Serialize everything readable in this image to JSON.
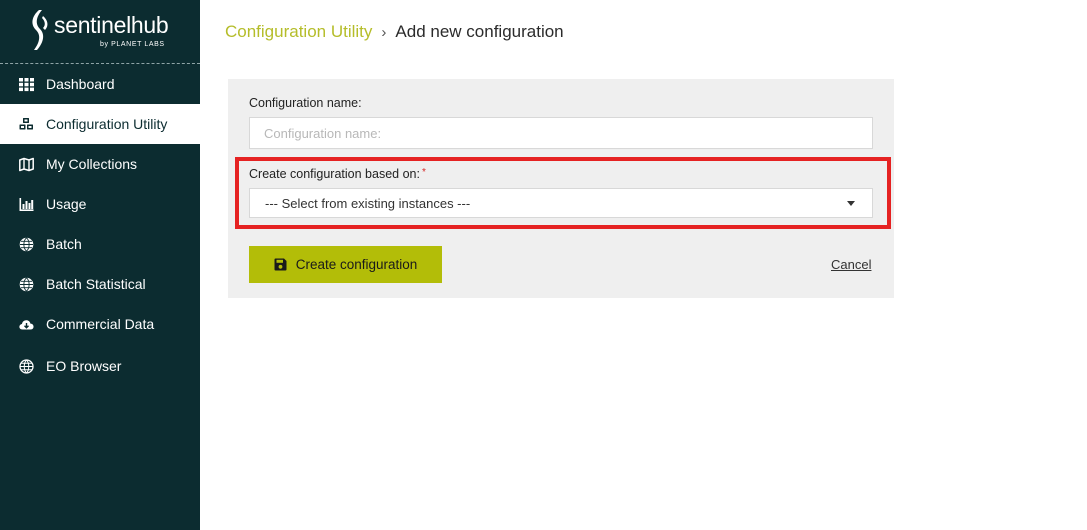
{
  "brand": {
    "name": "sentinelhub",
    "tagline": "by PLANET LABS"
  },
  "sidebar": {
    "items": [
      {
        "label": "Dashboard",
        "icon": "grid-icon"
      },
      {
        "label": "Configuration Utility",
        "icon": "cubes-icon",
        "active": true
      },
      {
        "label": "My Collections",
        "icon": "map-icon"
      },
      {
        "label": "Usage",
        "icon": "bar-chart-icon"
      },
      {
        "label": "Batch",
        "icon": "globe-icon"
      },
      {
        "label": "Batch Statistical",
        "icon": "globe-icon"
      },
      {
        "label": "Commercial Data",
        "icon": "cloud-download-icon"
      },
      {
        "label": "EO Browser",
        "icon": "globe-outline-icon"
      }
    ]
  },
  "breadcrumb": {
    "parent": "Configuration Utility",
    "separator": "›",
    "current": "Add new configuration"
  },
  "form": {
    "name_label": "Configuration name:",
    "name_placeholder": "Configuration name:",
    "name_value": "",
    "based_on_label": "Create configuration based on:",
    "required_mark": "*",
    "based_on_selected": "--- Select from existing instances ---",
    "create_label": "Create configuration",
    "cancel_label": "Cancel"
  },
  "colors": {
    "sidebar": "#0c2c30",
    "accent": "#b3bd08",
    "crumb": "#b5bd2a",
    "highlight": "#e52222"
  }
}
